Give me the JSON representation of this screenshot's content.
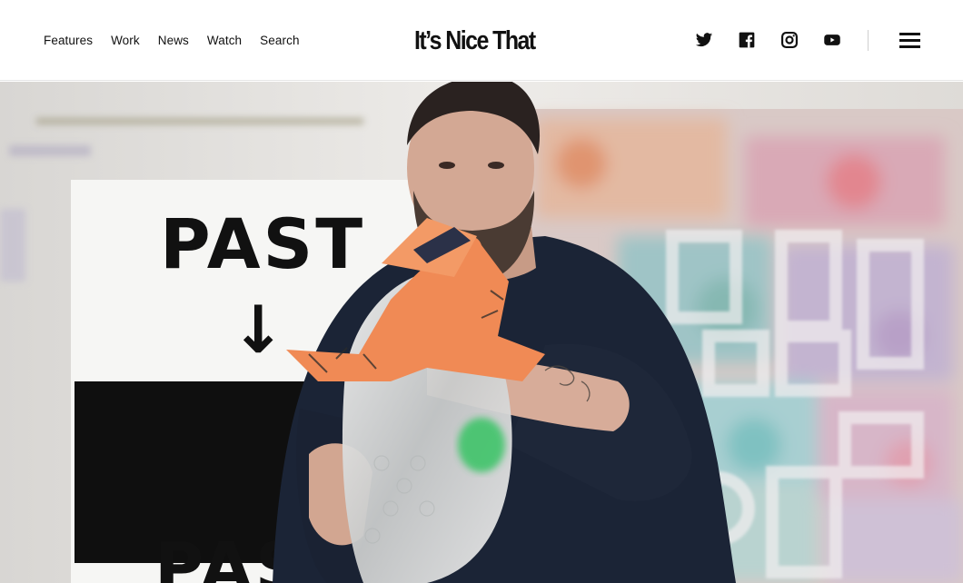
{
  "header": {
    "nav": [
      {
        "label": "Features"
      },
      {
        "label": "Work"
      },
      {
        "label": "News"
      },
      {
        "label": "Watch"
      },
      {
        "label": "Search"
      }
    ],
    "logo": "It’s Nice That",
    "social": [
      {
        "icon": "twitter-icon"
      },
      {
        "icon": "facebook-icon"
      },
      {
        "icon": "instagram-icon"
      },
      {
        "icon": "youtube-icon"
      }
    ],
    "menu_icon": "hamburger-menu-icon"
  },
  "hero": {
    "sign_text_top": "PAST",
    "sign_arrow": "↓",
    "sign_text_bottom": "PAST"
  },
  "colors": {
    "text": "#111111",
    "accent_orange": "#f08a55",
    "sweater": "#1b2436"
  }
}
